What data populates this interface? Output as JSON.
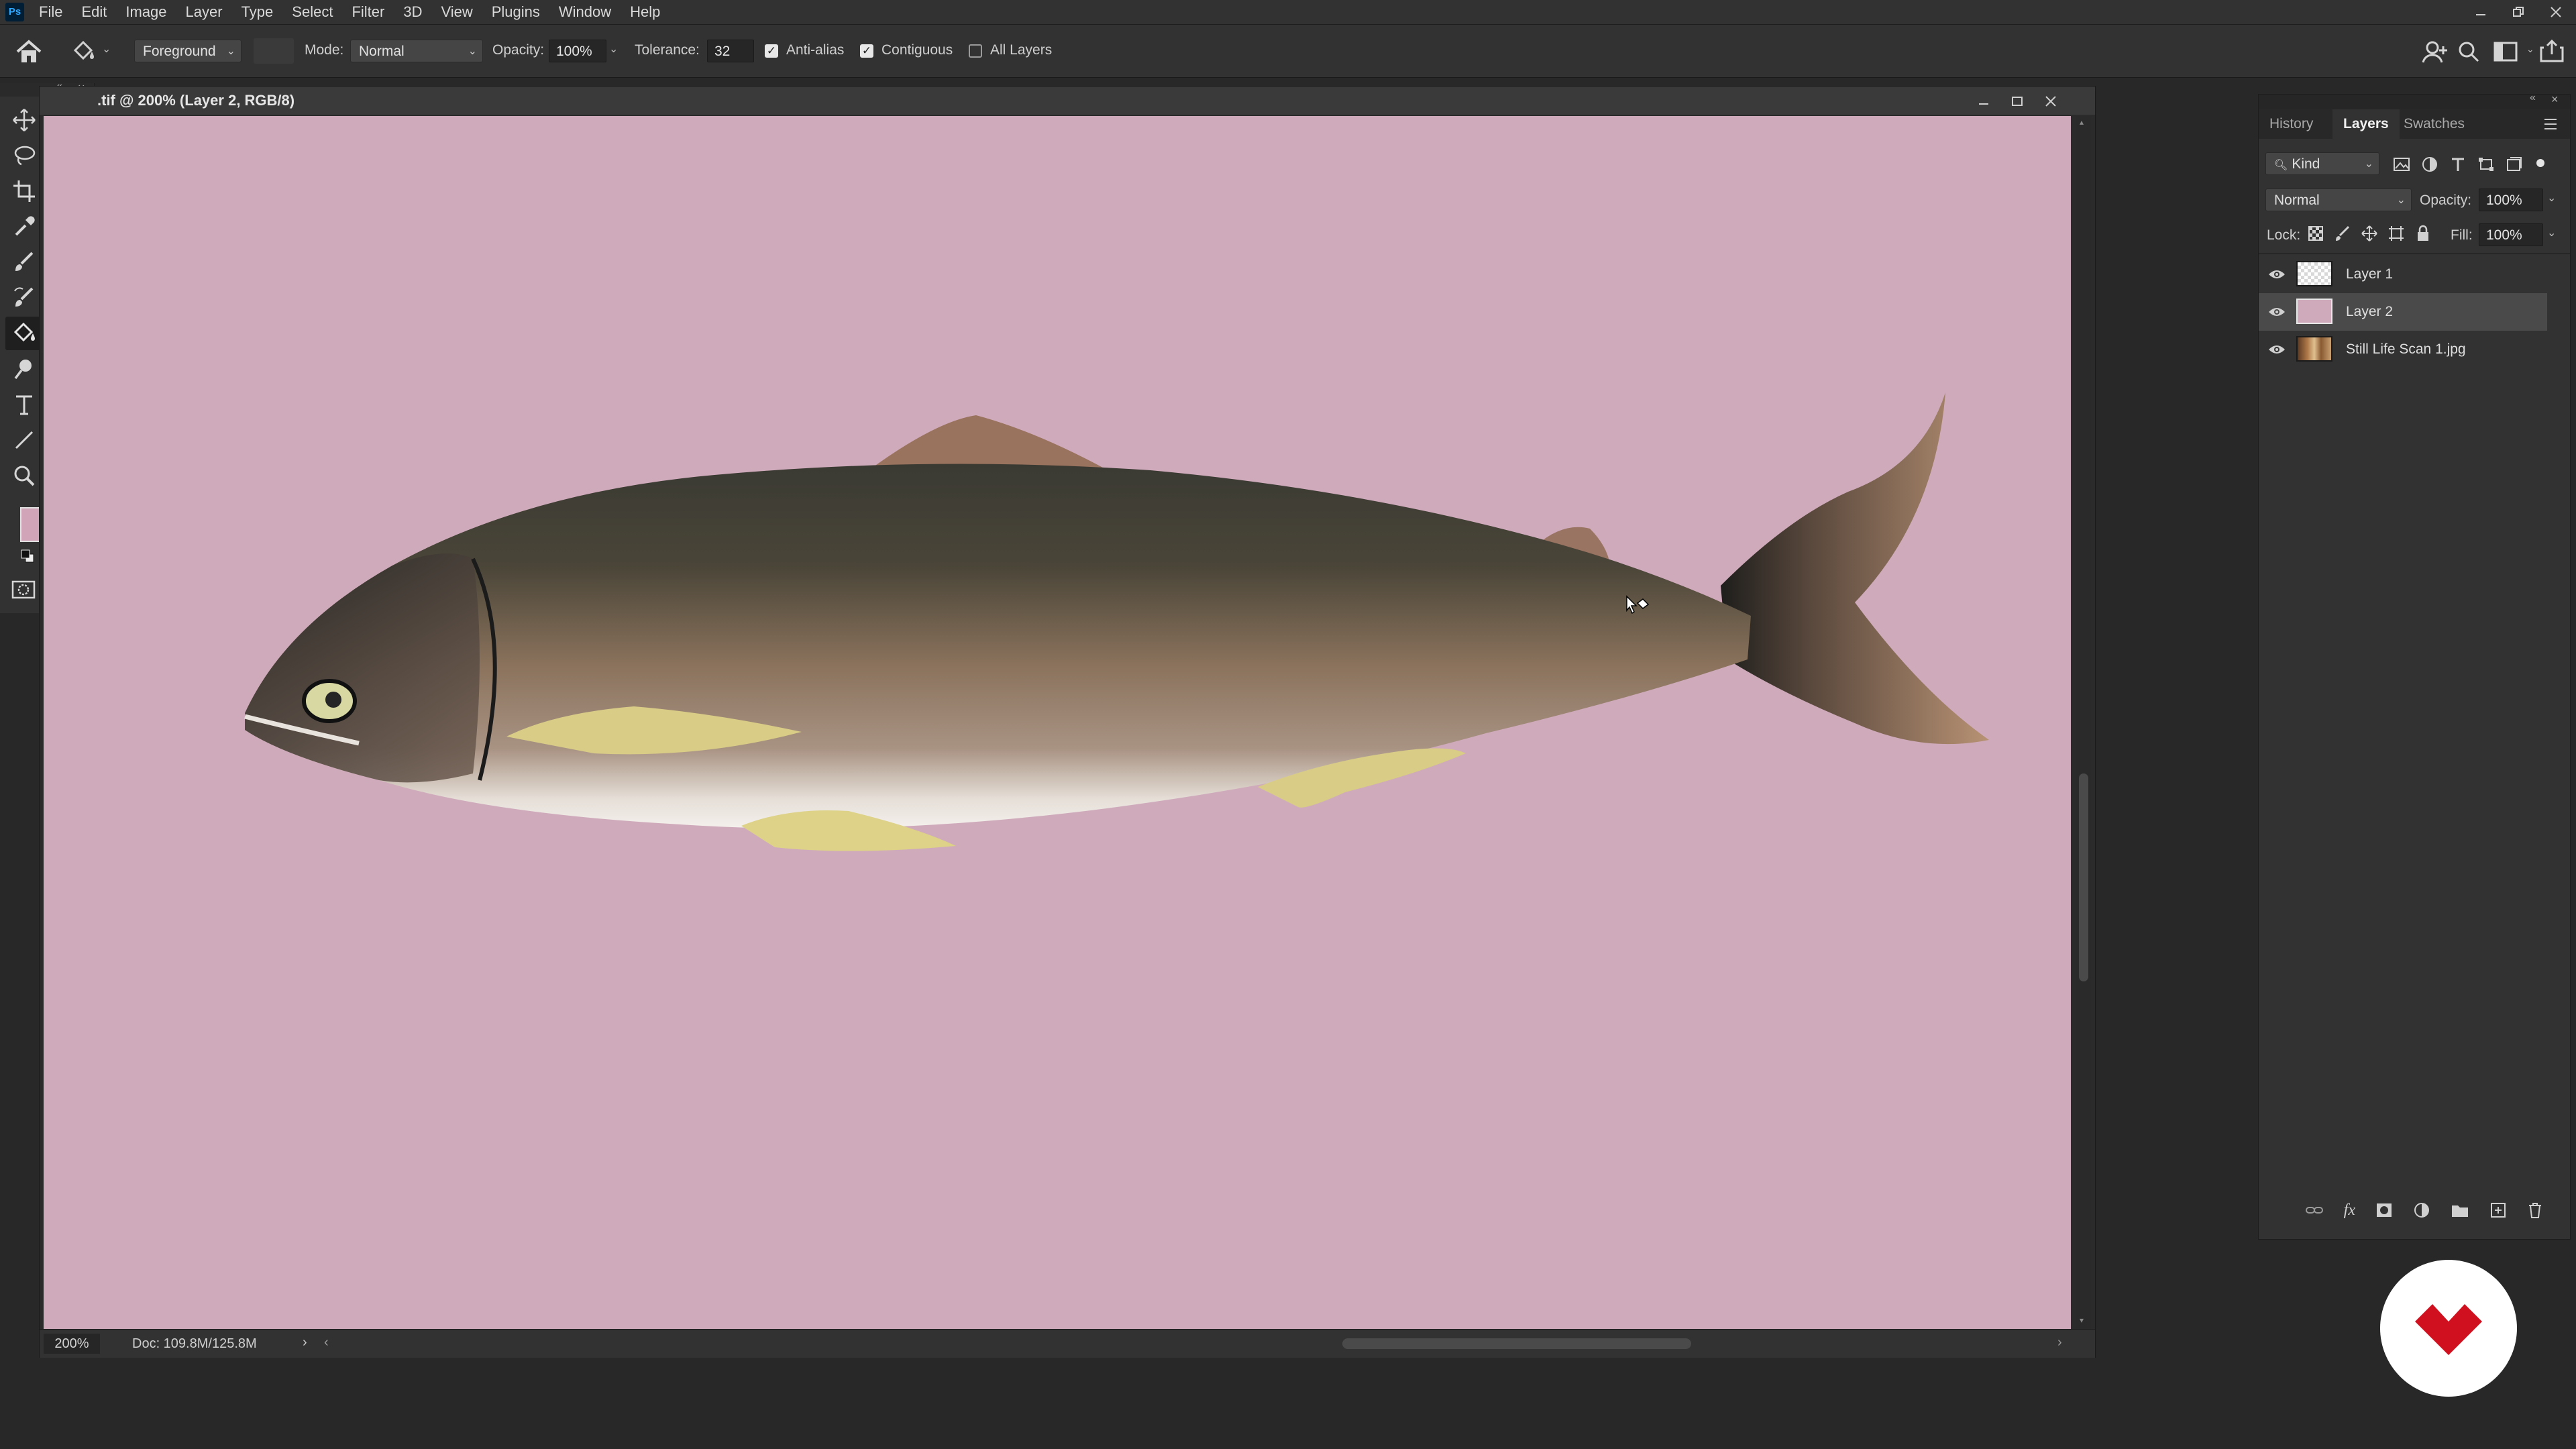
{
  "app": {
    "logo_text": "Ps",
    "menu": [
      "File",
      "Edit",
      "Image",
      "Layer",
      "Type",
      "Select",
      "Filter",
      "3D",
      "View",
      "Plugins",
      "Window",
      "Help"
    ]
  },
  "options_bar": {
    "fill_source": "Foreground",
    "mode_label": "Mode:",
    "mode_value": "Normal",
    "opacity_label": "Opacity:",
    "opacity_value": "100%",
    "tolerance_label": "Tolerance:",
    "tolerance_value": "32",
    "anti_alias_label": "Anti-alias",
    "anti_alias_checked": true,
    "contiguous_label": "Contiguous",
    "contiguous_checked": true,
    "all_layers_label": "All Layers",
    "all_layers_checked": false
  },
  "colors": {
    "foreground": "#d2a4b8",
    "background": "#cf9fb5",
    "canvas_fill": "#cfaabb",
    "brand_red": "#d0101e"
  },
  "document": {
    "title": ".tif @ 200% (Layer 2, RGB/8)",
    "zoom": "200%",
    "doc_info": "Doc: 109.8M/125.8M"
  },
  "panel": {
    "tabs": [
      "History",
      "Layers",
      "Swatches"
    ],
    "active_tab": "Layers",
    "filter_kind": "Kind",
    "blend_mode": "Normal",
    "opacity_label": "Opacity:",
    "opacity_value": "100%",
    "lock_label": "Lock:",
    "fill_label": "Fill:",
    "fill_value": "100%",
    "layers": [
      {
        "name": "Layer 1",
        "visible": true,
        "selected": false,
        "thumb": "transparent"
      },
      {
        "name": "Layer 2",
        "visible": true,
        "selected": true,
        "thumb": "pink"
      },
      {
        "name": "Still Life Scan 1.jpg",
        "visible": true,
        "selected": false,
        "thumb": "photo"
      }
    ]
  }
}
